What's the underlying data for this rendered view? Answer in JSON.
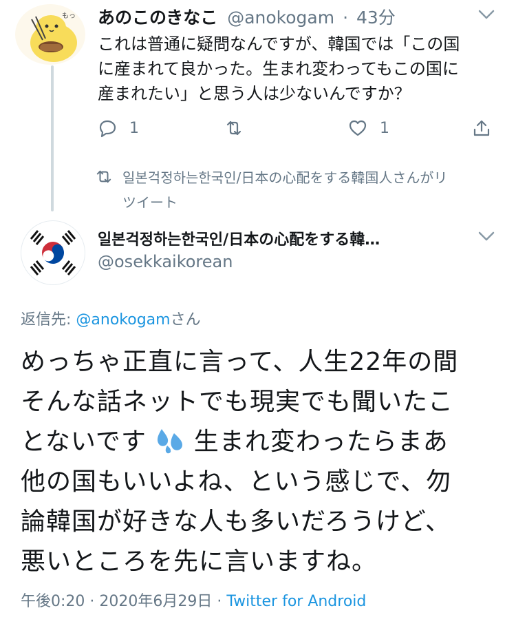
{
  "original_tweet": {
    "display_name": "あのこのきなこ",
    "handle": "@anokogam",
    "separator": "·",
    "time_ago": "43分",
    "lines": [
      "これは普通に疑問なんですが、韓国では「この国",
      "に産まれて良かった。生まれ変わってもこの国に",
      "産まれたい」と思う人は少ないんですか？"
    ],
    "reply_count": "1",
    "like_count": "1",
    "icons": [
      "reply-icon",
      "retweet-icon",
      "like-icon",
      "share-icon",
      "chevron-down-icon"
    ]
  },
  "retweet_notice": {
    "line1": "일본걱정하는한국인/日本の心配をする韓国人さんがリ",
    "line2": "ツイート"
  },
  "reply_tweet": {
    "display_name": "일본걱정하는한국인/日本の心配をする韓…",
    "handle": "@osekkaikorean",
    "reply_to_prefix": "返信先: ",
    "reply_to_handle": "@anokogam",
    "reply_to_suffix": "さん",
    "body_lines": [
      "めっちゃ正直に言って、人生22年の間",
      "そんな話ネットでも現実でも聞いたこ",
      "とないです",
      " 生まれ変わったらまあ",
      "他の国もいいよね、という感じで、勿",
      "論韓国が好きな人も多いだろうけど、",
      "悪いところを先に言いますね。"
    ],
    "emoji": "sweat-droplets-emoji",
    "timestamp": "午後0:20 · 2020年6月29日 · ",
    "client": "Twitter for Android"
  },
  "colors": {
    "text": "#14171a",
    "muted": "#657786",
    "link": "#1b95e0",
    "thread_line": "#cfd9de",
    "flag_red": "#cd2e3a",
    "flag_blue": "#0047a0"
  }
}
